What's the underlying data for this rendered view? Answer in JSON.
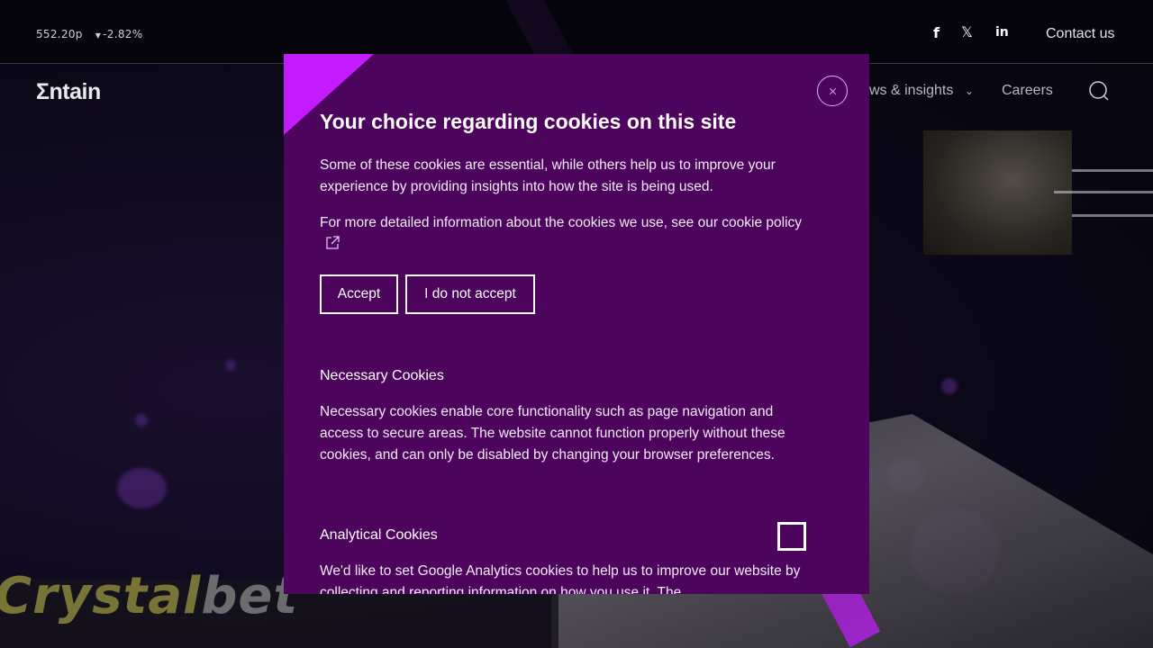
{
  "stock": {
    "price": "552.20p",
    "change_arrow": "▼",
    "change": "-2.82%"
  },
  "social": {
    "facebook_icon": "f",
    "x_icon": "𝕏",
    "linkedin_icon": "in"
  },
  "header": {
    "contact_label": "Contact us",
    "logo_text": "Σntain"
  },
  "nav": {
    "items": [
      {
        "label": "ws & insights",
        "chevron": "⌄"
      },
      {
        "label": "Careers"
      }
    ]
  },
  "background": {
    "brand_text_1": "Crystal",
    "brand_text_2": "bet"
  },
  "modal": {
    "title": "Your choice regarding cookies on this site",
    "intro": "Some of these cookies are essential, while others help us to improve your experience by providing insights into how the site is being used.",
    "more_info": "For more detailed information about the cookies we use, see our cookie policy",
    "accept_label": "Accept",
    "reject_label": "I do not accept",
    "sections": [
      {
        "heading": "Necessary Cookies",
        "body": "Necessary cookies enable core functionality such as page navigation and access to secure areas. The website cannot function properly without these cookies, and can only be disabled by changing your browser preferences."
      },
      {
        "heading": "Analytical Cookies",
        "body": "We'd like to set Google Analytics cookies to help us to improve our website by collecting and reporting information on how you use it. The",
        "checked": false
      }
    ]
  },
  "colors": {
    "modal_bg": "#4c045c",
    "accent": "#c21bff"
  }
}
